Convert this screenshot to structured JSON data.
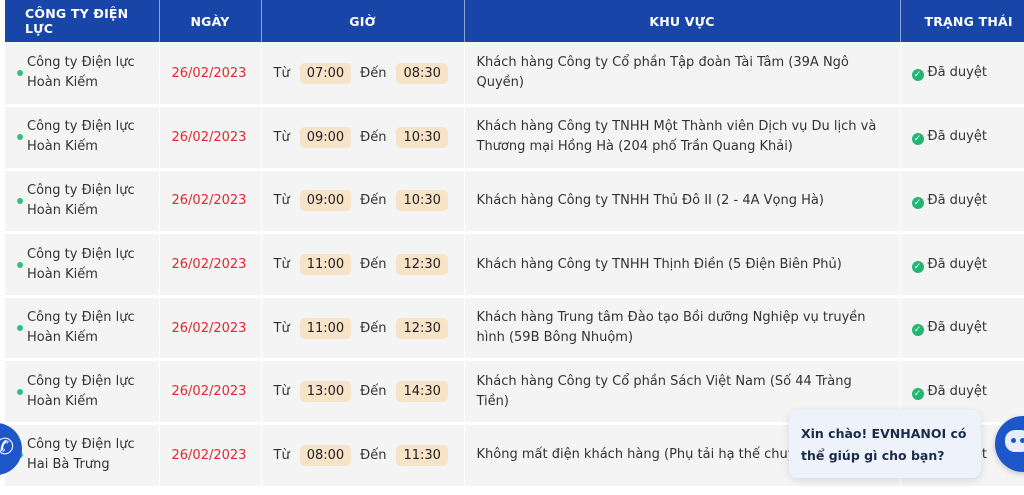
{
  "header": {
    "company": "CÔNG TY ĐIỆN LỰC",
    "date": "NGÀY",
    "time": "GIỜ",
    "area": "KHU VỰC",
    "status": "TRẠNG THÁI"
  },
  "labels": {
    "from": "Từ",
    "to": "Đến"
  },
  "rows": [
    {
      "company": "Công ty Điện lực Hoàn Kiếm",
      "date": "26/02/2023",
      "from": "07:00",
      "to": "08:30",
      "area": "Khách hàng Công ty Cổ phần Tập đoàn Tài Tâm (39A Ngô Quyền)",
      "status": "Đã duyệt"
    },
    {
      "company": "Công ty Điện lực Hoàn Kiếm",
      "date": "26/02/2023",
      "from": "09:00",
      "to": "10:30",
      "area": "Khách hàng Công ty TNHH Một Thành viên Dịch vụ Du lịch và Thương mại Hồng Hà (204 phố Trần Quang Khải)",
      "status": "Đã duyệt"
    },
    {
      "company": "Công ty Điện lực Hoàn Kiếm",
      "date": "26/02/2023",
      "from": "09:00",
      "to": "10:30",
      "area": "Khách hàng Công ty TNHH Thủ Đô II (2 - 4A Vọng Hà)",
      "status": "Đã duyệt"
    },
    {
      "company": "Công ty Điện lực Hoàn Kiếm",
      "date": "26/02/2023",
      "from": "11:00",
      "to": "12:30",
      "area": "Khách hàng Công ty TNHH Thịnh Điền (5 Điện Biên Phủ)",
      "status": "Đã duyệt"
    },
    {
      "company": "Công ty Điện lực Hoàn Kiếm",
      "date": "26/02/2023",
      "from": "11:00",
      "to": "12:30",
      "area": "Khách hàng Trung tâm Đào tạo Bồi dưỡng Nghiệp vụ truyền hình (59B Bông Nhuộm)",
      "status": "Đã duyệt"
    },
    {
      "company": "Công ty Điện lực Hoàn Kiếm",
      "date": "26/02/2023",
      "from": "13:00",
      "to": "14:30",
      "area": "Khách hàng Công ty Cổ phần Sách Việt Nam (Số 44 Tràng Tiền)",
      "status": "Đã duyệt"
    },
    {
      "company": "Công ty Điện lực Hai Bà Trưng",
      "date": "26/02/2023",
      "from": "08:00",
      "to": "11:30",
      "area": "Không mất điện khách hàng (Phụ tải hạ thế chuyển san",
      "status": "Đã duyệt"
    }
  ],
  "chat": {
    "message": "Xin chào! EVNHANOI có thể giúp gì cho bạn?"
  },
  "icons": {
    "status": "check-circle-icon",
    "chatbot": "chatbot-icon",
    "side": "phone-icon"
  },
  "colors": {
    "header_bg": "#1845a8",
    "date_text": "#e0282e",
    "time_pill": "#f7e4c8",
    "status_check": "#22b573",
    "dot": "#2ec27e"
  }
}
